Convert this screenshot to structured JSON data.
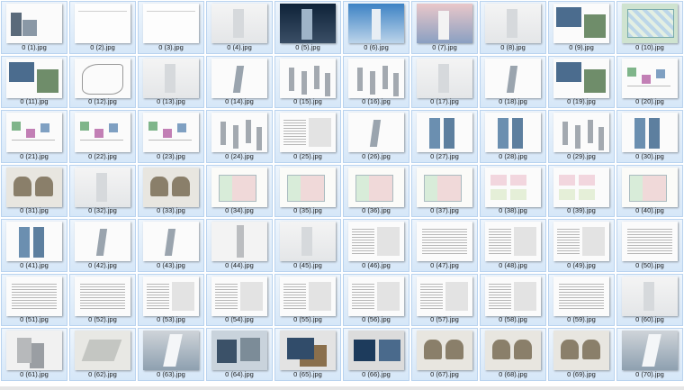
{
  "files": [
    {
      "name": "0 (1).jpg",
      "art": "cover"
    },
    {
      "name": "0 (2).jpg",
      "art": "blank"
    },
    {
      "name": "0 (3).jpg",
      "art": "blank"
    },
    {
      "name": "0 (4).jpg",
      "art": "haze"
    },
    {
      "name": "0 (5).jpg",
      "art": "night"
    },
    {
      "name": "0 (6).jpg",
      "art": "day"
    },
    {
      "name": "0 (7).jpg",
      "art": "dusk"
    },
    {
      "name": "0 (8).jpg",
      "art": "haze"
    },
    {
      "name": "0 (9).jpg",
      "art": "photos"
    },
    {
      "name": "0 (10).jpg",
      "art": "map"
    },
    {
      "name": "0 (11).jpg",
      "art": "photos"
    },
    {
      "name": "0 (12).jpg",
      "art": "sketch"
    },
    {
      "name": "0 (13).jpg",
      "art": "haze"
    },
    {
      "name": "0 (14).jpg",
      "art": "tower"
    },
    {
      "name": "0 (15).jpg",
      "art": "towers"
    },
    {
      "name": "0 (16).jpg",
      "art": "towers"
    },
    {
      "name": "0 (17).jpg",
      "art": "haze"
    },
    {
      "name": "0 (18).jpg",
      "art": "tower"
    },
    {
      "name": "0 (19).jpg",
      "art": "photos"
    },
    {
      "name": "0 (20).jpg",
      "art": "diagram"
    },
    {
      "name": "0 (21).jpg",
      "art": "diagram"
    },
    {
      "name": "0 (22).jpg",
      "art": "diagram"
    },
    {
      "name": "0 (23).jpg",
      "art": "diagram"
    },
    {
      "name": "0 (24).jpg",
      "art": "towers"
    },
    {
      "name": "0 (25).jpg",
      "art": "text2"
    },
    {
      "name": "0 (26).jpg",
      "art": "tower"
    },
    {
      "name": "0 (27).jpg",
      "art": "blue"
    },
    {
      "name": "0 (28).jpg",
      "art": "blue"
    },
    {
      "name": "0 (29).jpg",
      "art": "towers"
    },
    {
      "name": "0 (30).jpg",
      "art": "blue"
    },
    {
      "name": "0 (31).jpg",
      "art": "render"
    },
    {
      "name": "0 (32).jpg",
      "art": "haze"
    },
    {
      "name": "0 (33).jpg",
      "art": "render"
    },
    {
      "name": "0 (34).jpg",
      "art": "plan"
    },
    {
      "name": "0 (35).jpg",
      "art": "plan"
    },
    {
      "name": "0 (36).jpg",
      "art": "plan"
    },
    {
      "name": "0 (37).jpg",
      "art": "plan"
    },
    {
      "name": "0 (38).jpg",
      "art": "plan2"
    },
    {
      "name": "0 (39).jpg",
      "art": "plan2"
    },
    {
      "name": "0 (40).jpg",
      "art": "plan"
    },
    {
      "name": "0 (41).jpg",
      "art": "blue"
    },
    {
      "name": "0 (42).jpg",
      "art": "tower"
    },
    {
      "name": "0 (43).jpg",
      "art": "tower"
    },
    {
      "name": "0 (44).jpg",
      "art": "tall"
    },
    {
      "name": "0 (45).jpg",
      "art": "haze"
    },
    {
      "name": "0 (46).jpg",
      "art": "text2"
    },
    {
      "name": "0 (47).jpg",
      "art": "text"
    },
    {
      "name": "0 (48).jpg",
      "art": "text2"
    },
    {
      "name": "0 (49).jpg",
      "art": "text2"
    },
    {
      "name": "0 (50).jpg",
      "art": "text"
    },
    {
      "name": "0 (51).jpg",
      "art": "text"
    },
    {
      "name": "0 (52).jpg",
      "art": "text"
    },
    {
      "name": "0 (53).jpg",
      "art": "text2"
    },
    {
      "name": "0 (54).jpg",
      "art": "text2"
    },
    {
      "name": "0 (55).jpg",
      "art": "text2"
    },
    {
      "name": "0 (56).jpg",
      "art": "text2"
    },
    {
      "name": "0 (57).jpg",
      "art": "text2"
    },
    {
      "name": "0 (58).jpg",
      "art": "text2"
    },
    {
      "name": "0 (59).jpg",
      "art": "text"
    },
    {
      "name": "0 (60).jpg",
      "art": "haze"
    },
    {
      "name": "0 (61).jpg",
      "art": "mass"
    },
    {
      "name": "0 (62).jpg",
      "art": "site"
    },
    {
      "name": "0 (63).jpg",
      "art": "aerial"
    },
    {
      "name": "0 (64).jpg",
      "art": "photo2"
    },
    {
      "name": "0 (65).jpg",
      "art": "photo3"
    },
    {
      "name": "0 (66).jpg",
      "art": "facade"
    },
    {
      "name": "0 (67).jpg",
      "art": "render"
    },
    {
      "name": "0 (68).jpg",
      "art": "render"
    },
    {
      "name": "0 (69).jpg",
      "art": "render"
    },
    {
      "name": "0 (70).jpg",
      "art": "aerial"
    }
  ]
}
